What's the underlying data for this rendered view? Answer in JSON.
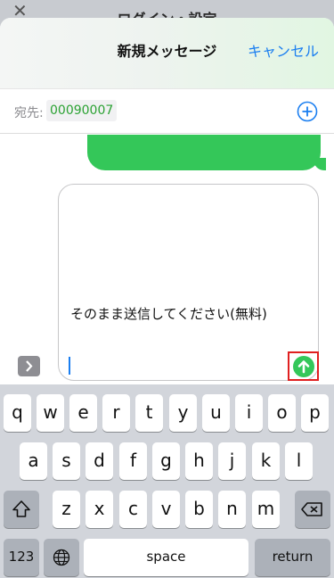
{
  "background_app": {
    "title": "ログイン・設定",
    "close_glyph": "✕"
  },
  "nav": {
    "title": "新規メッセージ",
    "cancel_label": "キャンセル"
  },
  "recipient": {
    "label": "宛先:",
    "value": "00090007"
  },
  "compose": {
    "text": "そのまま送信してください(無料)"
  },
  "colors": {
    "accent": "#1a7ef0",
    "bubble": "#34c759",
    "highlight": "#e02020",
    "recipient_text": "#2ca234"
  },
  "keyboard": {
    "row1": [
      "q",
      "w",
      "e",
      "r",
      "t",
      "y",
      "u",
      "i",
      "o",
      "p"
    ],
    "row2": [
      "a",
      "s",
      "d",
      "f",
      "g",
      "h",
      "j",
      "k",
      "l"
    ],
    "row3": [
      "z",
      "x",
      "c",
      "v",
      "b",
      "n",
      "m"
    ],
    "numbers_label": "123",
    "space_label": "space",
    "return_label": "return"
  },
  "icons": [
    "close-icon",
    "add-recipient-icon",
    "expand-icon",
    "send-arrow-icon",
    "shift-icon",
    "delete-icon",
    "globe-icon"
  ]
}
